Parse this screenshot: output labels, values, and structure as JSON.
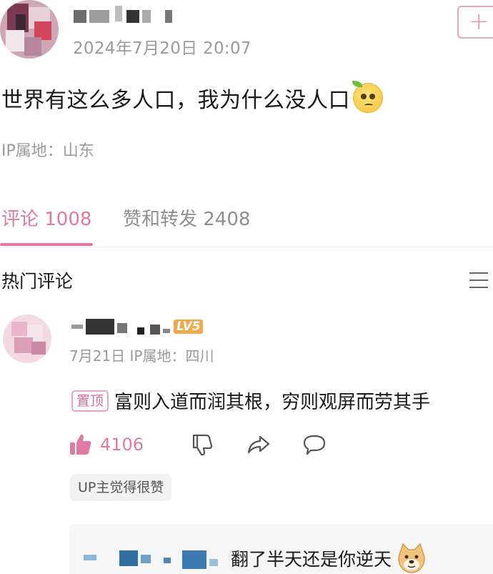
{
  "post": {
    "time": "2024年7月20日 20:07",
    "follow_label": "+",
    "content": "世界有这么多人口，我为什么没人口",
    "emoji": "worried-face-emoji",
    "ip_location": "IP属地：山东"
  },
  "tabs": [
    {
      "label": "评论 1008",
      "active": true
    },
    {
      "label": "赞和转发 2408",
      "active": false
    }
  ],
  "hot_comments": {
    "title": "热门评论",
    "sort_icon": "list-icon"
  },
  "comment": {
    "level": "LV5",
    "meta": "7月21日  IP属地：四川",
    "pin_label": "置顶",
    "content": "富则入道而润其根，穷则观屏而劳其手",
    "like_count": "4106",
    "up_tag": "UP主觉得很赞",
    "reply_text": "翻了半天还是你逆天",
    "reply_emoji": "doge-emoji"
  },
  "colors": {
    "accent_pink": "#e07aa4",
    "muted_gray": "#9a9a9a",
    "level_orange": "#f0a94a"
  }
}
